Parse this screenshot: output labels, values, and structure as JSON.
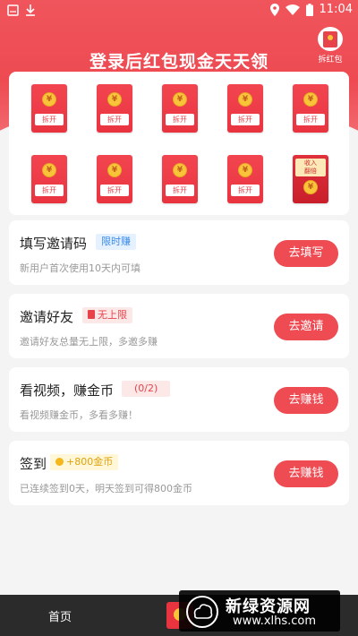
{
  "status_bar": {
    "time": "11:04"
  },
  "header": {
    "title": "登录后红包现金天天领",
    "corner_label": "拆红包"
  },
  "red_packets": {
    "open_label": "拆开",
    "coin_symbol": "¥",
    "special_tag": "收入\n翻倍"
  },
  "tasks": [
    {
      "title": "填写邀请码",
      "badge": "限时赚",
      "badge_style": "blue",
      "desc": "新用户首次使用10天内可填",
      "action": "去填写"
    },
    {
      "title": "邀请好友",
      "badge": "无上限",
      "badge_style": "red",
      "desc": "邀请好友总量无上限，多邀多赚",
      "action": "去邀请"
    },
    {
      "title": "看视频，赚金币",
      "badge": "(0/2)",
      "badge_style": "red",
      "desc": "看视频赚金币，多看多赚！",
      "action": "去赚钱"
    },
    {
      "title": "签到",
      "badge": "+800金币",
      "badge_style": "yellow",
      "desc": "已连续签到0天，明天签到可得800金币",
      "action": "去赚钱"
    }
  ],
  "bottom_nav": {
    "home_label": "首页"
  },
  "watermark": {
    "title": "新绿资源网",
    "url": "www.xlhs.com"
  },
  "colors": {
    "brand_red": "#ee4b53",
    "background": "#f4f4f4"
  }
}
